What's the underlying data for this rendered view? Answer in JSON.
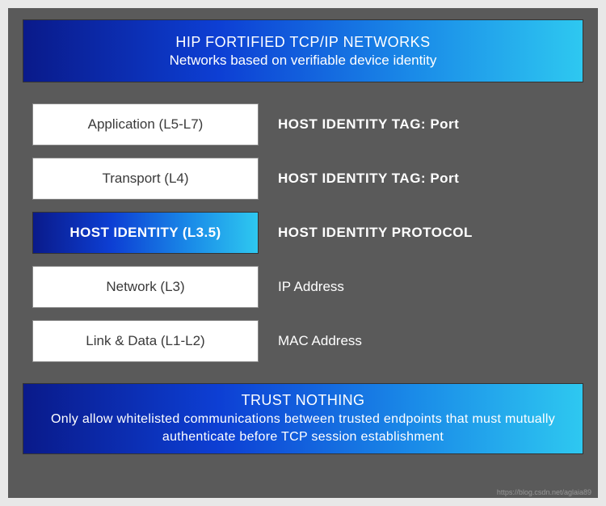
{
  "header": {
    "title": "HIP FORTIFIED TCP/IP NETWORKS",
    "subtitle": "Networks based on verifiable device identity"
  },
  "layers": [
    {
      "name": "Application (L5-L7)",
      "desc": "HOST IDENTITY  TAG: Port",
      "strong": true,
      "hip": false
    },
    {
      "name": "Transport (L4)",
      "desc": "HOST IDENTITY  TAG: Port",
      "strong": true,
      "hip": false
    },
    {
      "name": "HOST IDENTITY (L3.5)",
      "desc": "HOST IDENTITY  PROTOCOL",
      "strong": true,
      "hip": true
    },
    {
      "name": "Network (L3)",
      "desc": "IP Address",
      "strong": false,
      "hip": false
    },
    {
      "name": "Link & Data (L1-L2)",
      "desc": "MAC Address",
      "strong": false,
      "hip": false
    }
  ],
  "footer": {
    "title": "TRUST NOTHING",
    "subtitle": "Only allow whitelisted communications between trusted endpoints that must mutually authenticate before TCP session establishment"
  },
  "credit": "https://blog.csdn.net/aglaia89",
  "colors": {
    "gradient_start": "#0a1a8a",
    "gradient_mid": "#1a8be8",
    "gradient_end": "#2ec8f0",
    "panel_bg": "#5a5a5a"
  }
}
